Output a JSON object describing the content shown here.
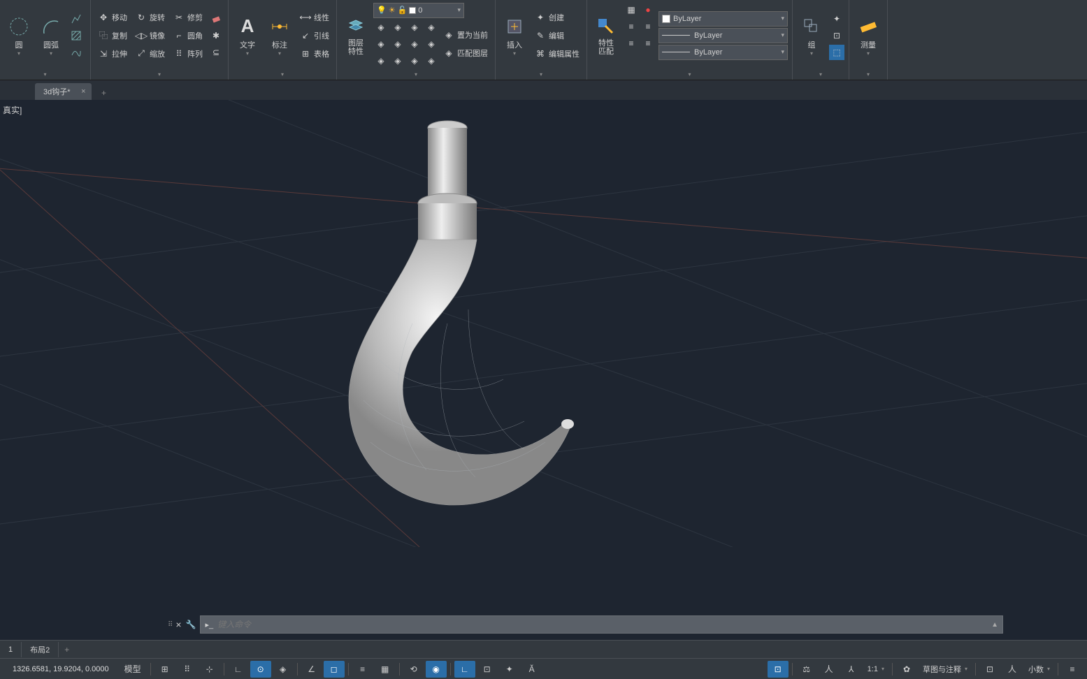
{
  "ribbon": {
    "draw": {
      "circle": "圆",
      "arc": "圆弧"
    },
    "modify": {
      "move": "移动",
      "rotate": "旋转",
      "trim": "修剪",
      "copy": "复制",
      "mirror": "镜像",
      "fillet": "圆角",
      "stretch": "拉伸",
      "scale": "缩放",
      "array": "阵列"
    },
    "annot": {
      "text": "文字",
      "dim": "标注",
      "linear": "线性",
      "leader": "引线",
      "table": "表格"
    },
    "layer": {
      "big": "图层\n特性",
      "current": "0",
      "make_current": "置为当前",
      "match": "匹配图层"
    },
    "block": {
      "insert": "插入",
      "create": "创建",
      "edit": "编辑",
      "editattr": "编辑属性"
    },
    "props": {
      "big": "特性\n匹配",
      "bylayer": "ByLayer"
    },
    "group": {
      "label": "组"
    },
    "util": {
      "measure": "测量"
    }
  },
  "tab": {
    "name": "3d钩子*",
    "add": "+"
  },
  "viewport": {
    "label": "真实]"
  },
  "cmd": {
    "placeholder": "键入命令"
  },
  "layouts": {
    "l1": "1",
    "l2": "布局2"
  },
  "status": {
    "coords": "1326.6581, 19.9204, 0.0000",
    "model": "模型",
    "scale": "1:1",
    "workspace": "草图与注释",
    "decimal": "小数"
  }
}
